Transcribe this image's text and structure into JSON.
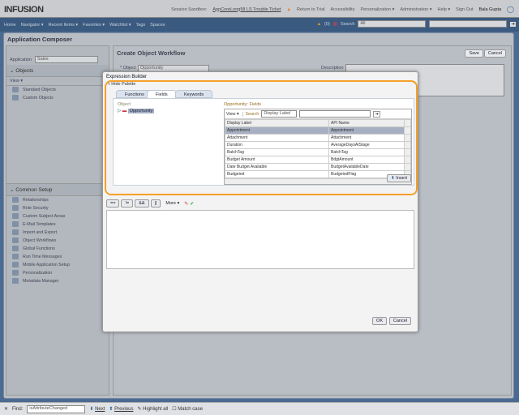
{
  "header": {
    "logo": "INFUSION",
    "session_label": "Session Sandbox:",
    "session_link": "AppCoreLong58 LS Trouble Ticket",
    "links": [
      "Return to Trial",
      "Accessibility",
      "Personalization ▾",
      "Administration ▾",
      "Help ▾",
      "Sign Out"
    ],
    "user": "Bala Gupta"
  },
  "nav": {
    "items": [
      "Home",
      "Navigator ▾",
      "Recent Items ▾",
      "Favorites ▾",
      "Watchlist ▾",
      "Tags",
      "Spaces"
    ],
    "notifications": "(0)",
    "search_label": "Search",
    "search_scope": "All",
    "search_value": ""
  },
  "app": {
    "title": "Application Composer",
    "application_label": "Application",
    "application_value": "Sales",
    "objects": {
      "title": "Objects",
      "view": "View ▾",
      "items": [
        "Standard Objects",
        "Custom Objects"
      ]
    },
    "common_setup": {
      "title": "Common Setup",
      "items": [
        "Relationships",
        "Role Security",
        "Custom Subject Areas",
        "E-Mail Templates",
        "Import and Export",
        "Object Workflows",
        "Global Functions",
        "Run Time Messages",
        "Mobile Application Setup",
        "Personalization",
        "Metadata Manager"
      ]
    },
    "workflow": {
      "title": "Create Object Workflow",
      "object_label": "* Object",
      "object_value": "Opportunity",
      "description_label": "Description",
      "save": "Save",
      "cancel": "Cancel"
    }
  },
  "dialog": {
    "title": "Expression Builder",
    "hide_palette": "Hide Palette",
    "tabs": [
      "Functions",
      "Fields",
      "Keywords"
    ],
    "active_tab": "Fields",
    "object_label": "Object",
    "object_tree_item": "Opportunity",
    "fields_title": "Opportunity: Fields",
    "view": "View ▾",
    "search_label": "Search",
    "search_by": "Display Label",
    "search_value": "",
    "columns": [
      "Display Label",
      "API Name"
    ],
    "rows": [
      [
        "Appointment",
        "Appointment"
      ],
      [
        "Attachment",
        "Attachment"
      ],
      [
        "Duration",
        "AverageDaysAtStage"
      ],
      [
        "BatchTag",
        "BatchTag"
      ],
      [
        "Budget Amount",
        "BdgtAmount"
      ],
      [
        "Date Budget Available",
        "BudgetAvailableDate"
      ],
      [
        "Budgeted",
        "BudgetedFlag"
      ]
    ],
    "insert": "Insert",
    "operators": [
      "==",
      "!=",
      "&&",
      "||"
    ],
    "more": "More ▾",
    "expression": "",
    "ok": "OK",
    "cancel": "Cancel"
  },
  "findbar": {
    "label": "Find:",
    "value": "isAttributeChanged",
    "next": "Next",
    "previous": "Previous",
    "highlight": "Highlight all",
    "match_case": "Match case"
  }
}
